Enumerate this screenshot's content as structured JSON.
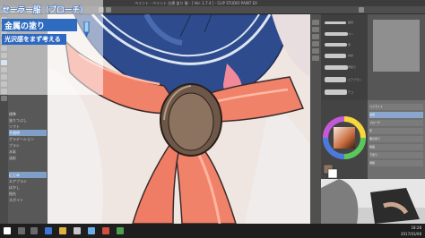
{
  "window": {
    "title": "ペイント - ペイント 白黒 塗り 服 - [ Ver. 1.7.4 ] - CLIP STUDIO PAINT EX"
  },
  "overlay": {
    "title": "セーラー服（ブローチ）",
    "subtitle": "金属の塗り",
    "caption": "光沢感をまず考える"
  },
  "subtool_panel": {
    "items": [
      "標準",
      "塗りつぶし",
      "ソフト",
      "不透明",
      "グラデーション",
      "ブラシ",
      "水彩",
      "油彩",
      "にじみ",
      "エアブラシ",
      "ぼかし",
      "指先",
      "スポイト"
    ]
  },
  "brush_panel": {
    "labels": [
      "鉛筆",
      "ペン",
      "筆",
      "水彩",
      "厚塗り",
      "エアブラシ",
      "デコ"
    ]
  },
  "layer_panel": {
    "rows": [
      "ハイライト",
      "金属",
      "ブローチ",
      "影",
      "服の塗り",
      "線画",
      "下塗り",
      "用紙"
    ]
  },
  "taskbar": {
    "time": "18:28",
    "date": "2017/03/08"
  },
  "colors": {
    "overlay_blue": "#2e68c0",
    "scarf_main": "#f0826a",
    "uniform_navy": "#2d4a8c",
    "brooch": "#8c7360"
  }
}
